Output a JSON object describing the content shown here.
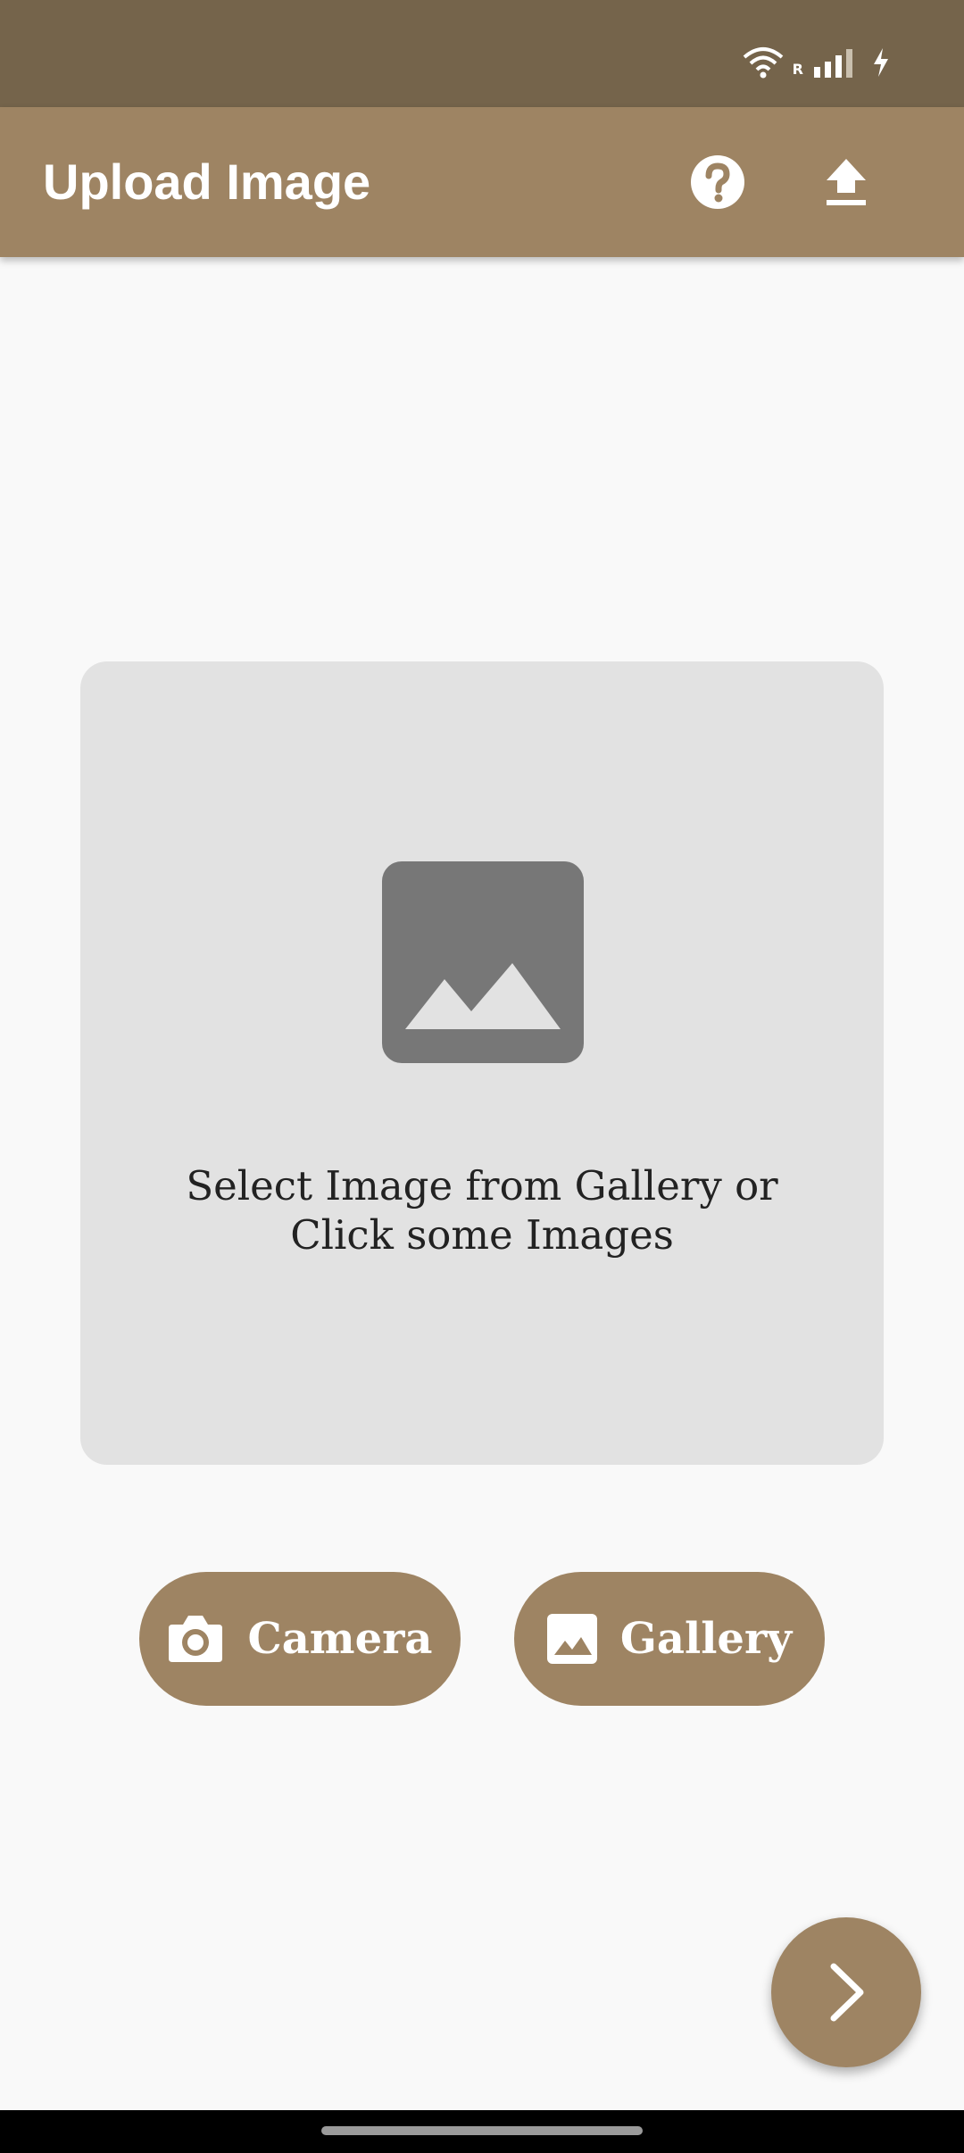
{
  "app_bar": {
    "title": "Upload Image",
    "background": "#9e8463",
    "actions": [
      {
        "icon": "help-circle-icon"
      },
      {
        "icon": "upload-icon"
      }
    ]
  },
  "status_bar": {
    "icons": [
      "wifi-icon",
      "roaming-signal-icon",
      "signal-icon",
      "battery-charging-icon"
    ],
    "roaming_label": "R",
    "background": "#75644b"
  },
  "placeholder": {
    "icon": "image-icon",
    "text": "Select Image from Gallery or Click some Images"
  },
  "buttons": {
    "camera_label": "Camera",
    "camera_icon": "camera-icon",
    "gallery_label": "Gallery",
    "gallery_icon": "image-icon"
  },
  "fab": {
    "icon": "chevron-right-icon"
  }
}
